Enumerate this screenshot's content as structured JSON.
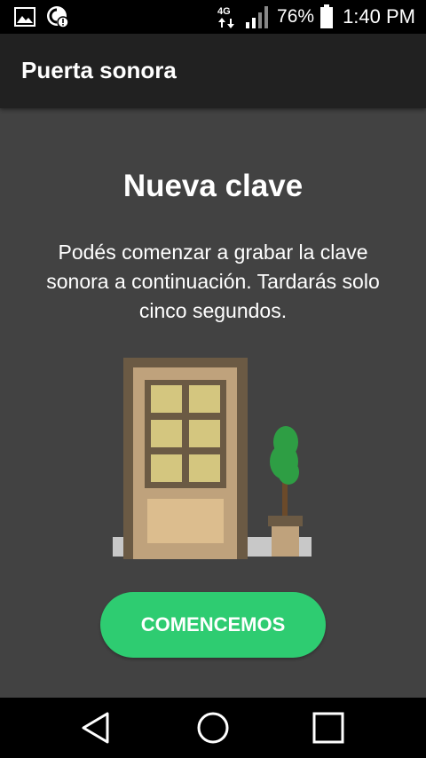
{
  "status_bar": {
    "network": "4G",
    "battery": "76%",
    "time": "1:40 PM",
    "icons": [
      "gallery-icon",
      "data-saver-icon",
      "network-4g-icon",
      "signal-icon",
      "battery-icon"
    ]
  },
  "app_bar": {
    "title": "Puerta sonora"
  },
  "content": {
    "heading": "Nueva clave",
    "description": "Podés comenzar a grabar la clave sonora a continuación. Tardarás solo cinco segundos.",
    "illustration": "door-with-plant-illustration",
    "button_label": "COMENCEMOS"
  },
  "nav_bar": {
    "icons": [
      "back-icon",
      "home-icon",
      "recents-icon"
    ]
  },
  "colors": {
    "background": "#424242",
    "app_bar": "#212121",
    "accent": "#2ecc71"
  }
}
